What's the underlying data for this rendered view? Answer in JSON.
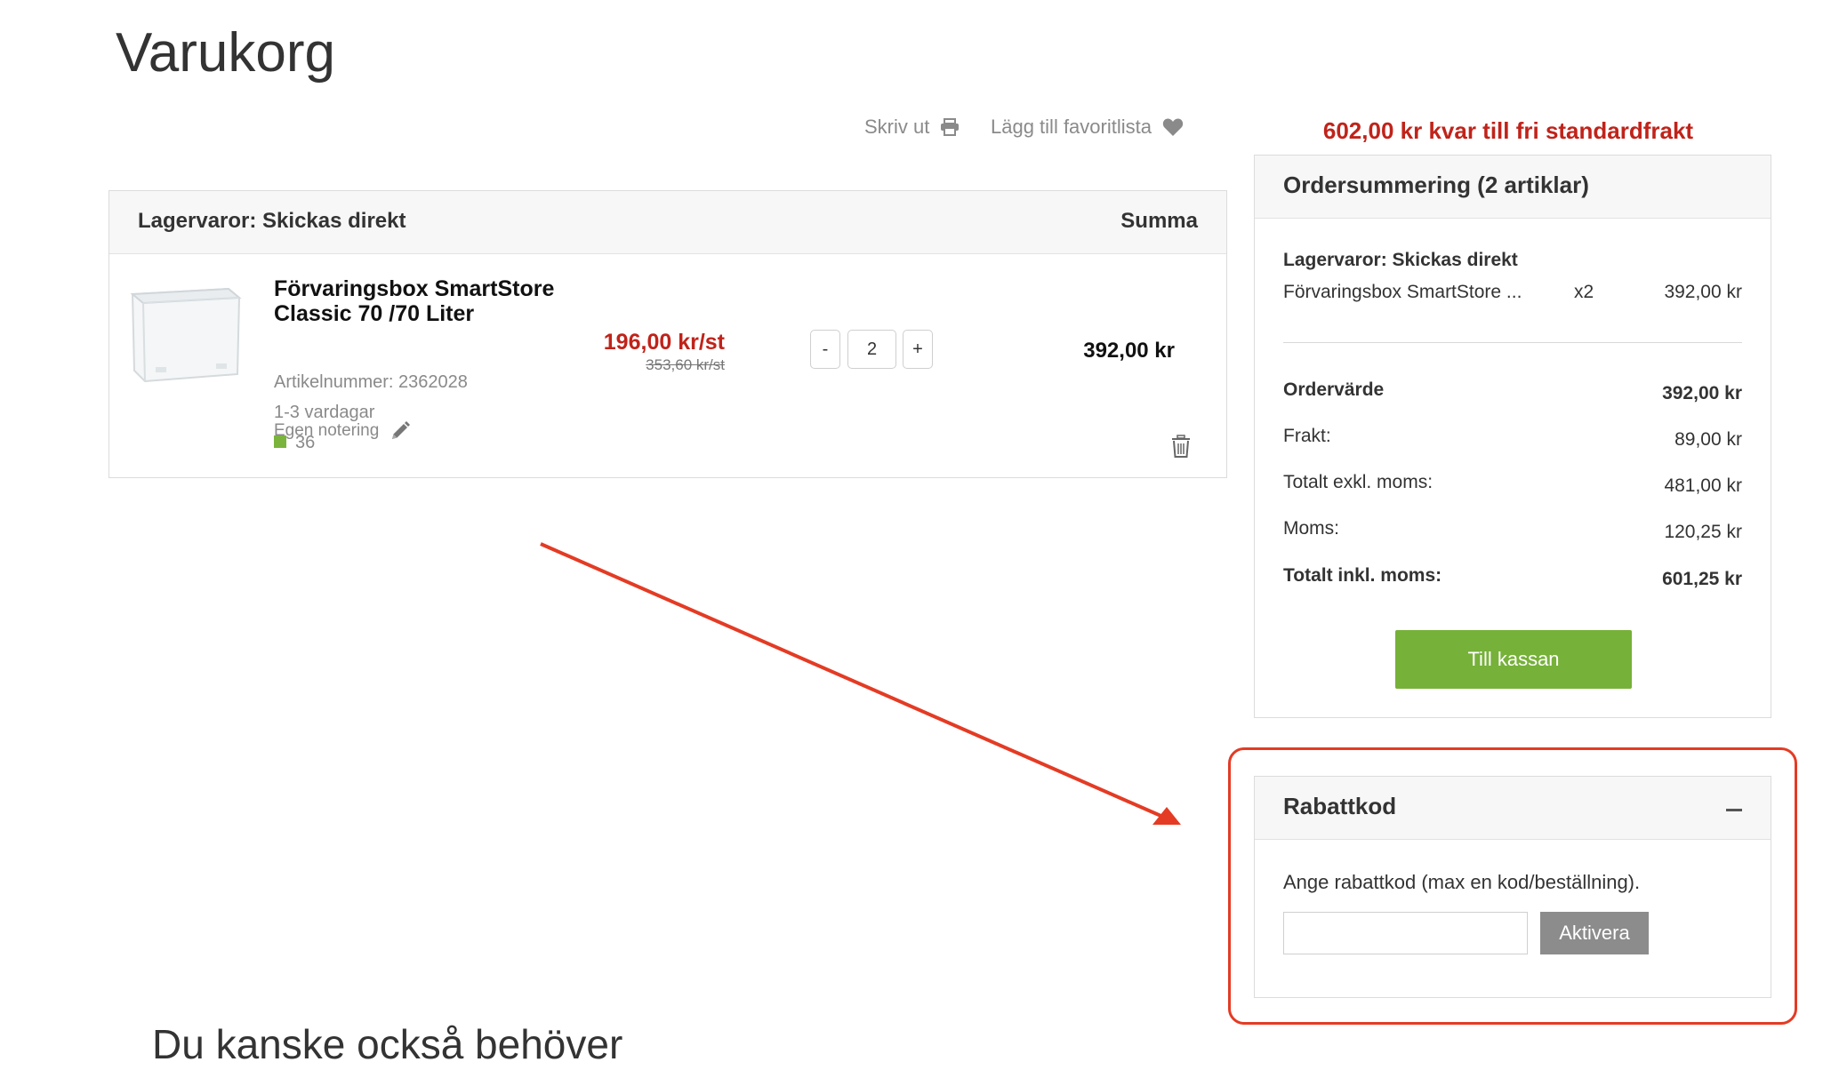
{
  "page": {
    "title": "Varukorg",
    "also_heading": "Du kanske också behöver"
  },
  "tools": {
    "print_label": "Skriv ut",
    "favorite_label": "Lägg till favoritlista"
  },
  "free_shipping_notice": "602,00 kr kvar till fri standardfrakt",
  "cart": {
    "group_label": "Lagervaror: Skickas direkt",
    "sum_header": "Summa",
    "item": {
      "name": "Förvaringsbox SmartStore Classic 70 /70 Liter",
      "article_number": "Artikelnummer: 2362028",
      "delivery": "1-3 vardagar",
      "stock": "36",
      "price": "196,00 kr/st",
      "old_price": "353,60 kr/st",
      "quantity": "2",
      "minus_label": "-",
      "plus_label": "+",
      "total": "392,00 kr",
      "note_label": "Egen notering"
    }
  },
  "summary": {
    "title": "Ordersummering (2 artiklar)",
    "group_label": "Lagervaror: Skickas direkt",
    "item_name": "Förvaringsbox SmartStore ...",
    "item_qty": "x2",
    "item_value": "392,00 kr",
    "rows": [
      {
        "label": "Ordervärde",
        "value": "392,00 kr"
      },
      {
        "label": "Frakt:",
        "value": "89,00 kr"
      },
      {
        "label": "Totalt exkl. moms:",
        "value": "481,00 kr"
      },
      {
        "label": "Moms:",
        "value": "120,25 kr"
      },
      {
        "label": "Totalt inkl. moms:",
        "value": "601,25 kr"
      }
    ],
    "checkout_label": "Till kassan"
  },
  "discount": {
    "title": "Rabattkod",
    "instruction": "Ange rabattkod (max en kod/beställning).",
    "input_value": "",
    "activate_label": "Aktivera"
  },
  "colors": {
    "accent_red": "#c0231a",
    "checkout_green": "#76b139",
    "stock_green": "#7bb43c",
    "annotation_red": "#e43b24"
  },
  "icons": [
    "printer-icon",
    "heart-icon",
    "pencil-icon",
    "trash-icon",
    "minus-icon"
  ]
}
